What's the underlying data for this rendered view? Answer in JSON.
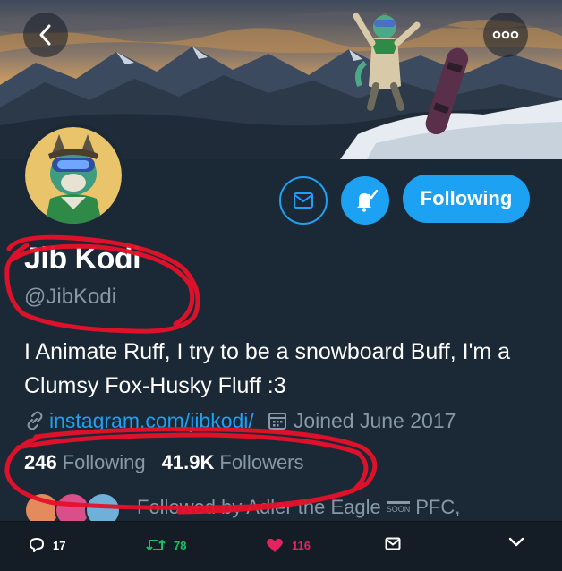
{
  "profile": {
    "name": "Jib Kodi",
    "handle": "@JibKodi",
    "bio": "I Animate Ruff, I try to be a snowboard Buff, I'm a Clumsy Fox-Husky Fluff :3",
    "link": "instagram.com/jibkodi/",
    "joined": "Joined June 2017"
  },
  "buttons": {
    "follow_label": "Following"
  },
  "stats": {
    "following_count": "246",
    "following_label": "Following",
    "followers_count": "41.9K",
    "followers_label": "Followers"
  },
  "followed_by": {
    "prefix": "Followed by Adler the Eagle",
    "badge": "SOON",
    "suffix": "PFC,"
  },
  "actions": {
    "replies": "17",
    "retweets": "78",
    "likes": "116"
  },
  "icons": {
    "back": "chevron-left-icon",
    "more": "more-dots-icon",
    "message": "envelope-icon",
    "notify": "bell-check-icon",
    "link": "link-icon",
    "calendar": "calendar-icon",
    "reply": "reply-bubble-icon",
    "retweet": "retweet-icon",
    "like": "heart-icon",
    "dm": "envelope-icon",
    "expand": "chevron-down-icon"
  },
  "colors": {
    "accent": "#1da1f2",
    "background": "#1b2836",
    "muted_text": "#8899a6",
    "retweet_green": "#17bf63",
    "like_red": "#e0245e",
    "annotation_red": "#e8102a"
  }
}
